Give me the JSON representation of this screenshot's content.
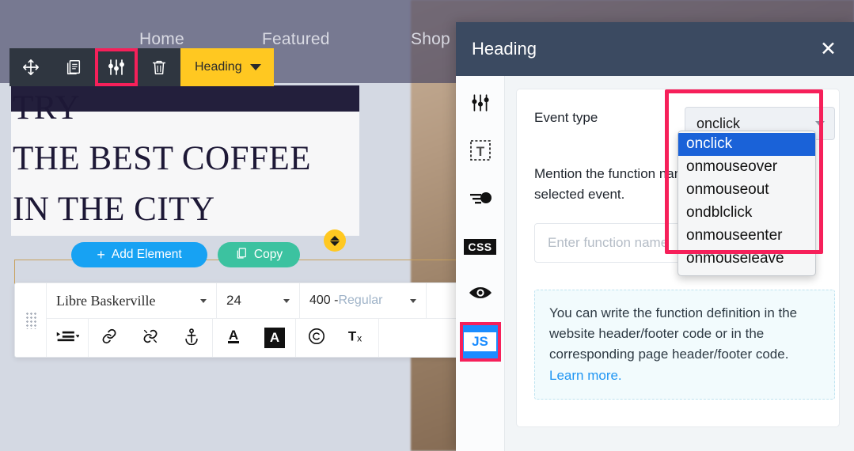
{
  "website": {
    "nav": [
      {
        "label": "Home"
      },
      {
        "label": "Featured"
      },
      {
        "label": "Shop"
      }
    ],
    "hero": {
      "line1": "TRY",
      "line2": "THE BEST COFFEE",
      "line3": "IN THE CITY"
    }
  },
  "element_toolbar": {
    "move_icon": "move-arrows-icon",
    "duplicate_icon": "copy-pages-icon",
    "settings_icon": "sliders-icon",
    "delete_icon": "trash-icon",
    "tag_label": "Heading",
    "tag_caret_icon": "chevron-down-icon"
  },
  "element_actions": {
    "add_label": "Add Element",
    "add_plus": "+",
    "copy_label": "Copy",
    "copy_icon": "copy-icon",
    "reorder_icon": "up-down-chevrons-icon"
  },
  "text_toolbar": {
    "font_family": "Libre Baskerville",
    "font_size": "24",
    "font_weight_number": "400 -",
    "font_weight_name": "Regular",
    "icons": [
      {
        "name": "indent-list-icon",
        "glyph": "list"
      },
      {
        "name": "link-icon",
        "glyph": "link"
      },
      {
        "name": "unlink-icon",
        "glyph": "unlink"
      },
      {
        "name": "anchor-icon",
        "glyph": "anchor"
      },
      {
        "name": "text-color-icon",
        "glyph": "A"
      },
      {
        "name": "text-highlight-icon",
        "glyph": "A"
      },
      {
        "name": "copyright-icon",
        "glyph": "©"
      },
      {
        "name": "clear-formatting-icon",
        "glyph": "Tx"
      }
    ],
    "grip_icon": "drag-grip-icon"
  },
  "panel": {
    "title": "Heading",
    "close_label": "✕",
    "rail": [
      {
        "name": "sliders-icon",
        "label": "Settings"
      },
      {
        "name": "text-box-icon",
        "label": "Text"
      },
      {
        "name": "animation-icon",
        "label": "Animation"
      },
      {
        "name": "css-icon",
        "label": "CSS"
      },
      {
        "name": "eye-icon",
        "label": "Visibility"
      },
      {
        "name": "js-icon",
        "label": "JS"
      }
    ],
    "css_chip": "CSS",
    "js_chip": "JS",
    "form": {
      "event_type_label": "Event type",
      "event_type_value": "onclick",
      "helper_text": "Mention the function name for the selected event.",
      "function_input_placeholder": "Enter function name",
      "function_input_value": ""
    },
    "info": {
      "text": "You can write the function definition in the website header/footer code or in the corresponding page header/footer code. ",
      "link_label": "Learn more."
    }
  },
  "dropdown": {
    "options": [
      {
        "label": "onclick",
        "selected": true
      },
      {
        "label": "onmouseover",
        "selected": false
      },
      {
        "label": "onmouseout",
        "selected": false
      },
      {
        "label": "ondblclick",
        "selected": false
      },
      {
        "label": "onmouseenter",
        "selected": false
      },
      {
        "label": "onmouseleave",
        "selected": false
      }
    ]
  },
  "colors": {
    "highlight_ring": "#f6205a",
    "panel_header": "#3b4a61",
    "accent_blue": "#1a8cff",
    "tag_yellow": "#ffc821",
    "add_blue": "#17a2f3",
    "copy_green": "#3cc2a0",
    "selected_option": "#1a62d8"
  }
}
